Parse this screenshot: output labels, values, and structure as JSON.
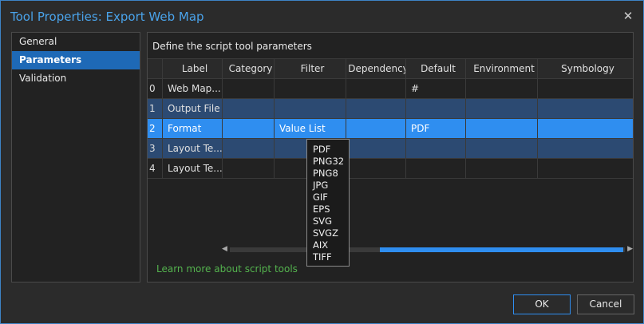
{
  "window": {
    "title": "Tool Properties: Export Web Map",
    "close_glyph": "✕"
  },
  "nav": {
    "items": [
      {
        "label": "General"
      },
      {
        "label": "Parameters"
      },
      {
        "label": "Validation"
      }
    ],
    "active": "Parameters"
  },
  "panel": {
    "description": "Define the script tool parameters"
  },
  "grid": {
    "columns": [
      "Label",
      "Category",
      "Filter",
      "Dependency",
      "Default",
      "Environment",
      "Symbology"
    ],
    "rows": [
      {
        "index": "0",
        "label": "Web Map...",
        "category": "",
        "filter": "",
        "dependency": "",
        "default": "#",
        "environment": "",
        "symbology": ""
      },
      {
        "index": "1",
        "label": "Output File",
        "category": "",
        "filter": "",
        "dependency": "",
        "default": "",
        "environment": "",
        "symbology": ""
      },
      {
        "index": "2",
        "label": "Format",
        "category": "",
        "filter": "Value List",
        "dependency": "",
        "default": "PDF",
        "environment": "",
        "symbology": ""
      },
      {
        "index": "3",
        "label": "Layout Te...",
        "category": "",
        "filter": "",
        "dependency": "",
        "default": "",
        "environment": "",
        "symbology": ""
      },
      {
        "index": "4",
        "label": "Layout Te...",
        "category": "",
        "filter": "",
        "dependency": "",
        "default": "",
        "environment": "",
        "symbology": ""
      }
    ]
  },
  "dropdown": {
    "options": [
      "PDF",
      "PNG32",
      "PNG8",
      "JPG",
      "GIF",
      "EPS",
      "SVG",
      "SVGZ",
      "AIX",
      "TIFF"
    ]
  },
  "scrollbar": {
    "left_arrow": "◀",
    "right_arrow": "▶"
  },
  "footer": {
    "learn_more": "Learn more about script tools",
    "ok_label": "OK",
    "cancel_label": "Cancel"
  },
  "colors": {
    "accent": "#2f8ef0",
    "title_blue": "#4aa3ea",
    "link_green": "#54b34e",
    "selected_row": "#2c4a72"
  }
}
